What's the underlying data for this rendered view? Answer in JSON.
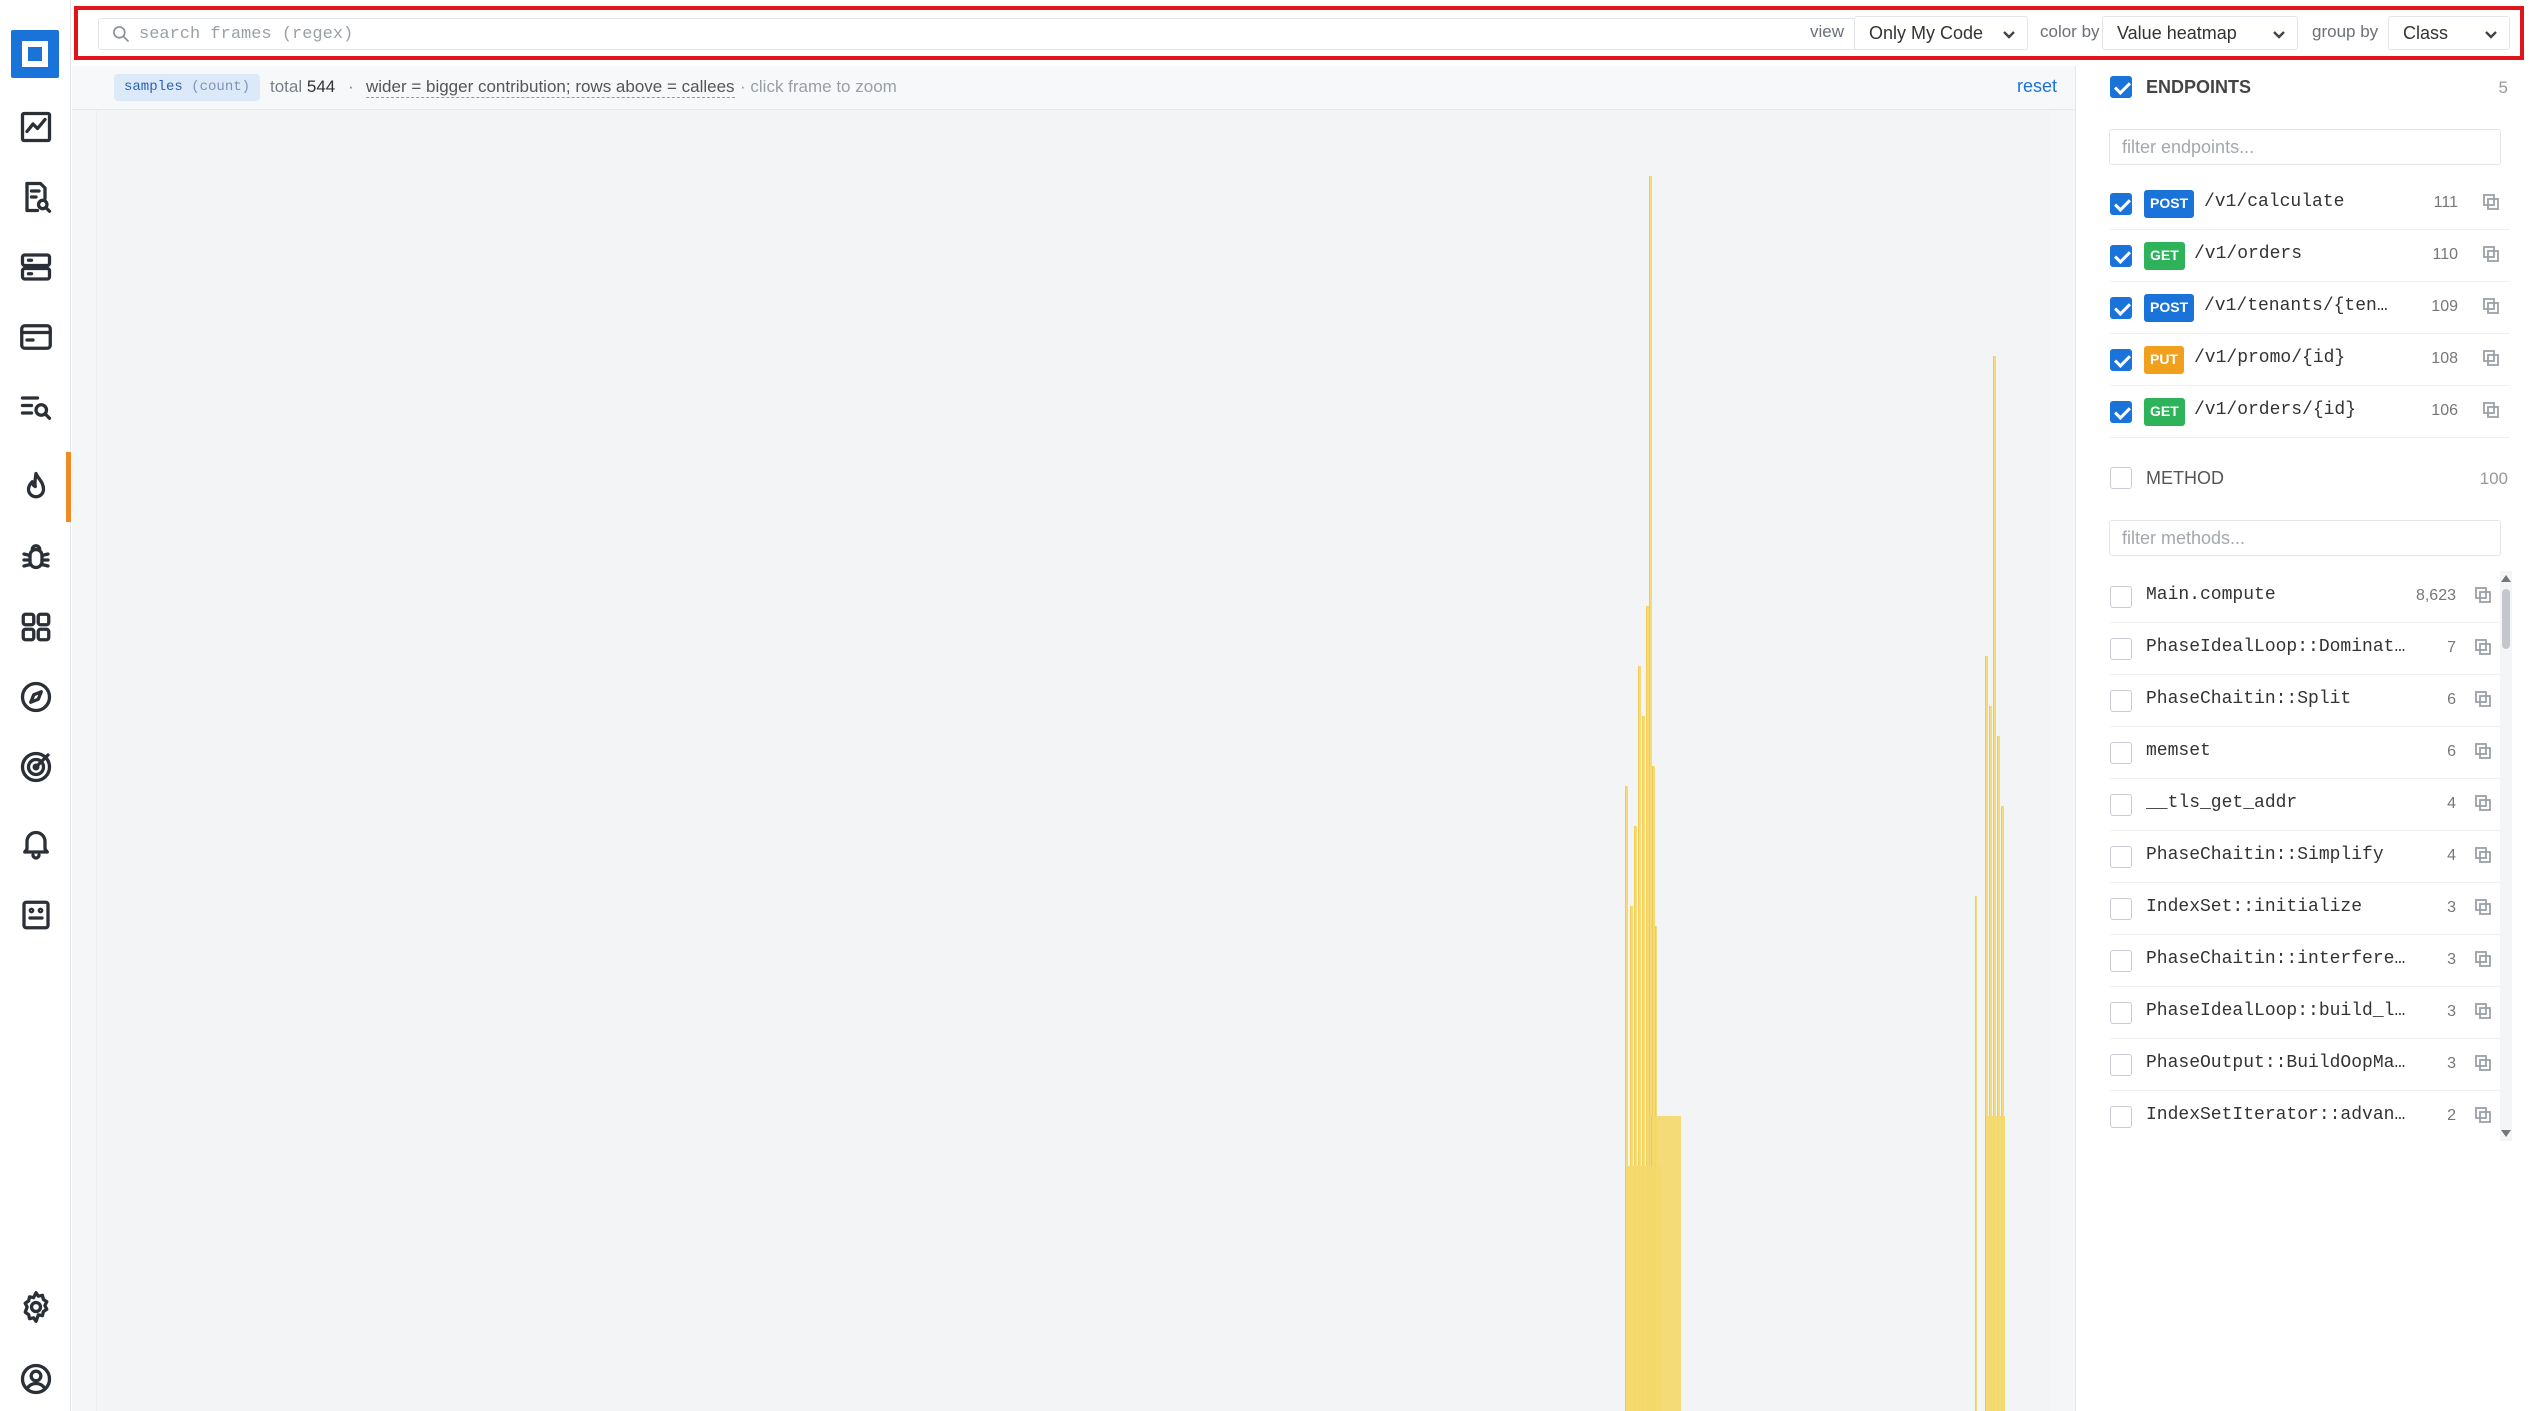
{
  "toolbar": {
    "search_placeholder": "search frames (regex)",
    "view_label": "view",
    "view_value": "Only My Code",
    "color_label": "color by",
    "color_value": "Value heatmap",
    "group_label": "group by",
    "group_value": "Class"
  },
  "infobar": {
    "samples_label": "samples",
    "samples_unit": "(count)",
    "total_label": "total",
    "total_value": "544",
    "dot": "·",
    "legend": "wider = bigger contribution; rows above = callees",
    "hint": "· click frame to zoom",
    "reset": "reset"
  },
  "endpoints": {
    "title": "ENDPOINTS",
    "count": "5",
    "filter_placeholder": "filter endpoints...",
    "items": [
      {
        "method": "POST",
        "path": "/v1/calculate",
        "count": "111"
      },
      {
        "method": "GET",
        "path": "/v1/orders",
        "count": "110"
      },
      {
        "method": "POST",
        "path": "/v1/tenants/{tenant…",
        "count": "109"
      },
      {
        "method": "PUT",
        "path": "/v1/promo/{id}",
        "count": "108"
      },
      {
        "method": "GET",
        "path": "/v1/orders/{id}",
        "count": "106"
      }
    ]
  },
  "methods": {
    "title": "METHOD",
    "count": "100",
    "filter_placeholder": "filter methods...",
    "items": [
      {
        "name": "Main.compute",
        "count": "8,623"
      },
      {
        "name": "PhaseIdealLoop::Dominators",
        "count": "7"
      },
      {
        "name": "PhaseChaitin::Split",
        "count": "6"
      },
      {
        "name": "memset",
        "count": "6"
      },
      {
        "name": "__tls_get_addr",
        "count": "4"
      },
      {
        "name": "PhaseChaitin::Simplify",
        "count": "4"
      },
      {
        "name": "IndexSet::initialize",
        "count": "3"
      },
      {
        "name": "PhaseChaitin::interfere_w…",
        "count": "3"
      },
      {
        "name": "PhaseIdealLoop::build_loo…",
        "count": "3"
      },
      {
        "name": "PhaseOutput::BuildOopMaps",
        "count": "3"
      },
      {
        "name": "IndexSetIterator::advance…",
        "count": "2"
      }
    ]
  },
  "colors": {
    "accent": "#1a73d9",
    "active_nav": "#f08a24",
    "highlight_border": "#e0141b",
    "frame_fill": "#f5d96b",
    "post": "#1a73d9",
    "get": "#2fb35a",
    "put": "#f0a01c"
  },
  "sidebar": {
    "icons": [
      "logo-icon",
      "chart-line-icon",
      "document-search-icon",
      "server-icon",
      "browser-window-icon",
      "list-search-icon",
      "flame-icon",
      "bug-icon",
      "grid-icon",
      "compass-icon",
      "target-icon",
      "bell-icon",
      "terminal-icon",
      "gear-icon",
      "user-circle-icon"
    ]
  }
}
